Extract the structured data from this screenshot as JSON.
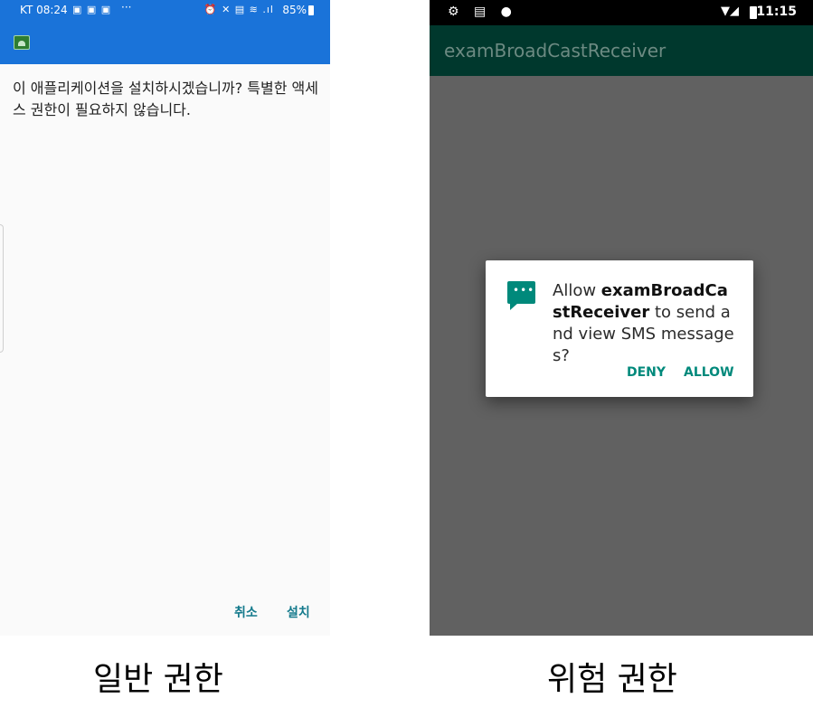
{
  "left_phone": {
    "status_bar": {
      "carrier_time": "KT 08:24",
      "notif_icons": "▣ ▣ ▣",
      "more": "···",
      "right_icons": "⏰ ✕ ▤ ≋ .ıl",
      "battery": "85%"
    },
    "message": "이 애플리케이션을 설치하시겠습니까? 특별한 액세스 권한이 필요하지 않습니다.",
    "buttons": {
      "cancel": "취소",
      "install": "설치"
    }
  },
  "right_phone": {
    "status_bar": {
      "left_icons": "⚙ ▤ ●",
      "signal": "▼◢",
      "time": "11:15"
    },
    "app_title": "examBroadCastReceiver",
    "dialog": {
      "icon": "sms-icon",
      "text_prefix": "Allow ",
      "app_name": "examBroadCastReceiver",
      "text_suffix": " to send and view SMS messages?",
      "deny": "DENY",
      "allow": "ALLOW",
      "accent_color": "#00897b"
    }
  },
  "captions": {
    "left": "일반 권한",
    "right": "위험 권한"
  },
  "colors": {
    "left_bar": "#1a73d9",
    "right_appbar": "#00382d",
    "right_background": "#616161"
  }
}
